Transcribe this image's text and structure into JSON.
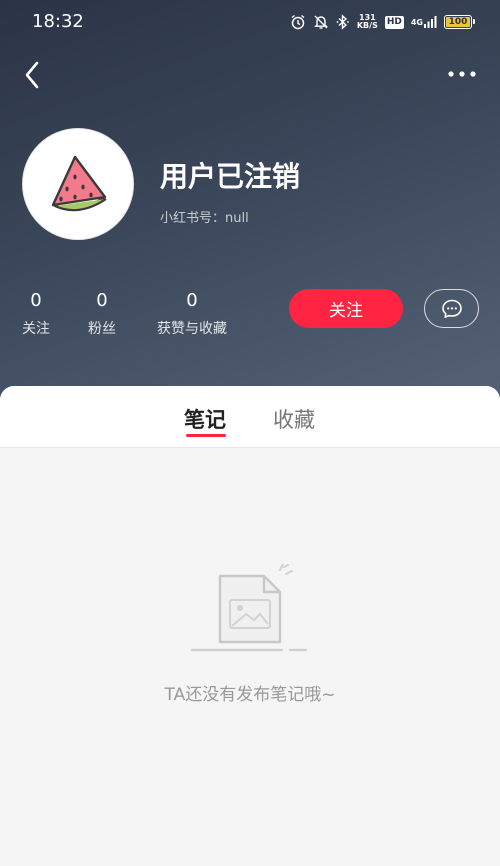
{
  "status_bar": {
    "time": "18:32",
    "net_speed_value": "131",
    "net_speed_unit": "KB/S",
    "hd_badge": "HD",
    "network_type": "4G",
    "battery": "100",
    "icons": [
      "alarm-icon",
      "mute-bell-icon",
      "bluetooth-icon",
      "signal-icon",
      "battery-icon"
    ]
  },
  "nav": {
    "back_icon": "chevron-left-icon",
    "more_icon": "more-dots-icon"
  },
  "profile": {
    "avatar_icon": "watermelon-icon",
    "name": "用户已注销",
    "id_label": "小红书号：null"
  },
  "stats": [
    {
      "value": "0",
      "label": "关注"
    },
    {
      "value": "0",
      "label": "粉丝"
    },
    {
      "value": "0",
      "label": "获赞与收藏"
    }
  ],
  "actions": {
    "follow_label": "关注",
    "chat_icon": "chat-bubble-icon"
  },
  "tabs": {
    "notes": "笔记",
    "collections": "收藏",
    "active": "notes"
  },
  "empty_state": {
    "icon": "empty-document-icon",
    "message": "TA还没有发布笔记哦~"
  },
  "colors": {
    "accent": "#ff2442",
    "header_dark": "#2b3446",
    "header_light": "#566276",
    "page_bg": "#f5f5f5",
    "battery_fill": "#e6c73c"
  }
}
